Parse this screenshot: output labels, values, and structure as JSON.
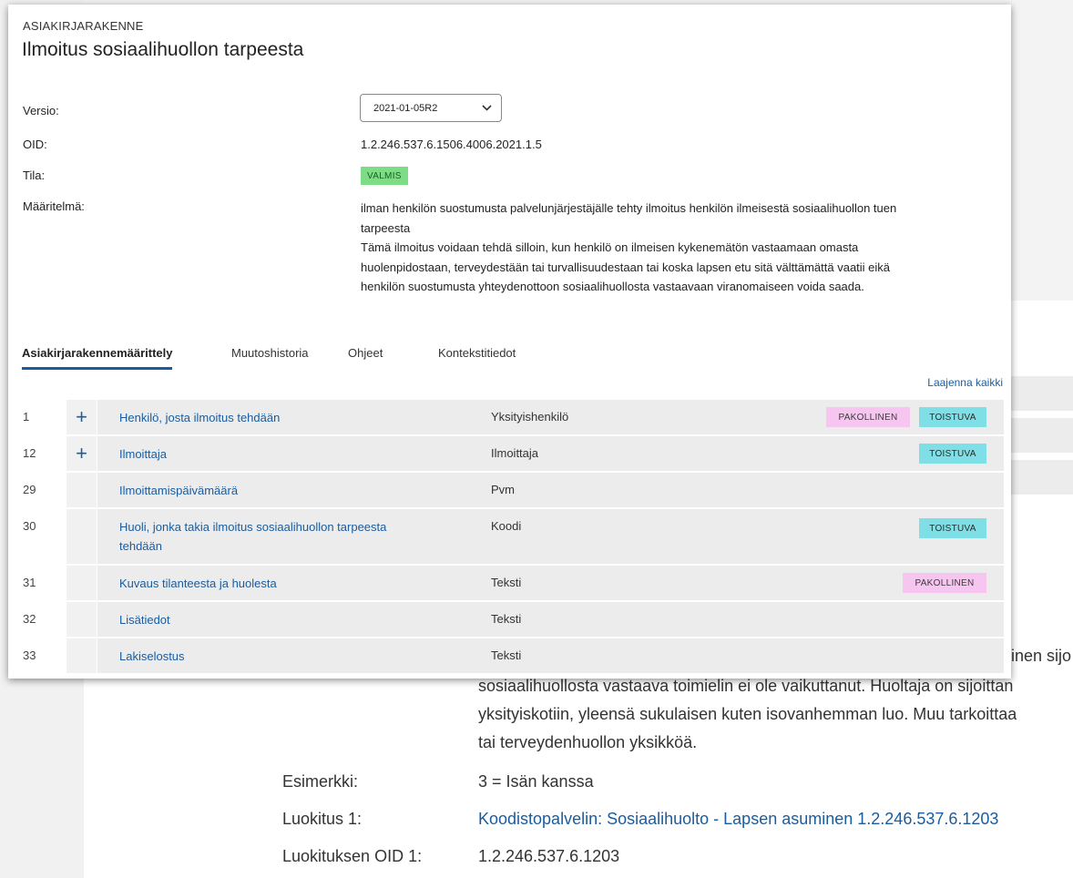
{
  "background": {
    "behind_row_text": "inen sijo",
    "paragraph_lines": [
      "sosiaalihuollosta vastaava toimielin ei ole vaikuttanut. Huoltaja on sijoittan",
      "yksityiskotiin, yleensä sukulaisen kuten isovanhemman luo. Muu tarkoittaa",
      "tai terveydenhuollon yksikköä."
    ],
    "fields": [
      {
        "label": "Esimerkki:",
        "value": "3 = Isän kanssa",
        "link": false
      },
      {
        "label": "Luokitus 1:",
        "value": "Koodistopalvelin: Sosiaalihuolto - Lapsen asuminen 1.2.246.537.6.1203",
        "link": true
      },
      {
        "label": "Luokituksen OID 1:",
        "value": "1.2.246.537.6.1203",
        "link": false
      }
    ]
  },
  "card": {
    "eyebrow": "ASIAKIRJARAKENNE",
    "title": "Ilmoitus sosiaalihuollon tarpeesta",
    "meta": {
      "version_label": "Versio:",
      "version_value": "2021-01-05R2",
      "oid_label": "OID:",
      "oid_value": "1.2.246.537.6.1506.4006.2021.1.5",
      "status_label": "Tila:",
      "status_value": "VALMIS",
      "definition_label": "Määritelmä:",
      "definition_lines": [
        "ilman henkilön suostumusta palvelunjärjestäjälle tehty ilmoitus henkilön ilmeisestä sosiaalihuollon tuen",
        "tarpeesta",
        "Tämä ilmoitus voidaan tehdä silloin, kun henkilö on ilmeisen kykenemätön vastaamaan omasta",
        "huolenpidostaan, terveydestään tai turvallisuudestaan tai koska lapsen etu sitä välttämättä vaatii eikä",
        "henkilön suostumusta yhteydenottoon sosiaalihuollosta vastaavaan viranomaiseen voida saada."
      ]
    },
    "tabs": [
      {
        "label": "Asiakirjarakennemäärittely",
        "active": true
      },
      {
        "label": "Muutoshistoria",
        "active": false
      },
      {
        "label": "Ohjeet",
        "active": false
      },
      {
        "label": "Kontekstitiedot",
        "active": false
      }
    ],
    "expand_all": "Laajenna kaikki",
    "rows": [
      {
        "num": "1",
        "expandable": true,
        "name": "Henkilö, josta ilmoitus tehdään",
        "type": "Yksityishenkilö",
        "tags": [
          "PAKOLLINEN",
          "TOISTUVA"
        ]
      },
      {
        "num": "12",
        "expandable": true,
        "name": "Ilmoittaja",
        "type": "Ilmoittaja",
        "tags": [
          "TOISTUVA"
        ]
      },
      {
        "num": "29",
        "expandable": false,
        "name": "Ilmoittamispäivämäärä",
        "type": "Pvm",
        "tags": []
      },
      {
        "num": "30",
        "expandable": false,
        "name": "Huoli, jonka takia ilmoitus sosiaalihuollon tarpeesta",
        "name2": "tehdään",
        "type": "Koodi",
        "tags": [
          "TOISTUVA"
        ]
      },
      {
        "num": "31",
        "expandable": false,
        "name": "Kuvaus tilanteesta ja huolesta",
        "type": "Teksti",
        "tags": [
          "PAKOLLINEN"
        ]
      },
      {
        "num": "32",
        "expandable": false,
        "name": "Lisätiedot",
        "type": "Teksti",
        "tags": []
      },
      {
        "num": "33",
        "expandable": false,
        "name": "Lakiselostus",
        "type": "Teksti",
        "tags": []
      }
    ]
  },
  "colors": {
    "link": "#1a5c9e",
    "valmis": "#7edc86",
    "pakollinen": "#f7c6f0",
    "toistuva": "#7fdfe6",
    "row_bg": "#ececec"
  }
}
